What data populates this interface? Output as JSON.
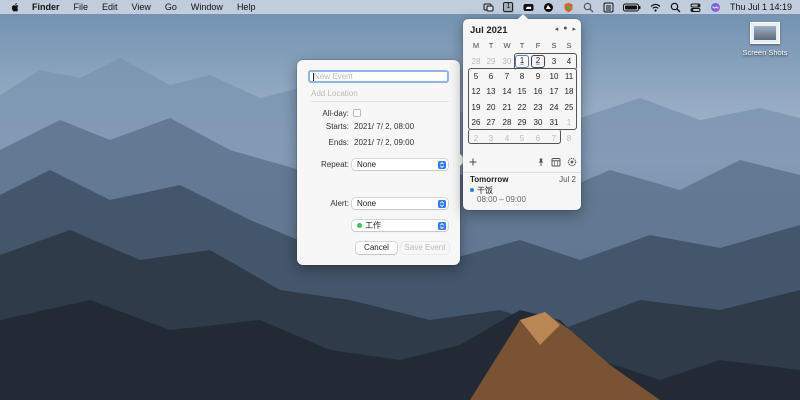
{
  "menubar": {
    "app_name": "Finder",
    "menus": [
      "File",
      "Edit",
      "View",
      "Go",
      "Window",
      "Help"
    ],
    "calendar_icon_day": "1",
    "clock": "Thu Jul 1  14:19",
    "status_icons": [
      "screen-share-icon",
      "calendar-day-icon",
      "cloud-icon",
      "dark-circle-icon",
      "shield-icon",
      "search-icon",
      "menu-list-icon",
      "battery-icon",
      "wifi-icon",
      "spotlight-icon",
      "control-center-icon",
      "siri-icon"
    ]
  },
  "desktop": {
    "items": [
      {
        "label": "Screen Shots"
      }
    ]
  },
  "event_dialog": {
    "title_placeholder": "New Event",
    "location_placeholder": "Add Location",
    "all_day_label": "All-day:",
    "starts_label": "Starts:",
    "starts_value": "2021/  7/  2, 08:00",
    "ends_label": "Ends:",
    "ends_value": "2021/  7/  2, 09:00",
    "repeat_label": "Repeat:",
    "repeat_value": "None",
    "alert_label": "Alert:",
    "alert_value": "None",
    "calendar_value": "工作",
    "calendar_color": "#35c759",
    "cancel_label": "Cancel",
    "save_label": "Save Event"
  },
  "calendar": {
    "month_label": "Jul 2021",
    "nav": {
      "prev": "◂",
      "today": "●",
      "next": "▸"
    },
    "weekdays": [
      "M",
      "T",
      "W",
      "T",
      "F",
      "S",
      "S"
    ],
    "weeks": [
      [
        "28",
        "29",
        "30",
        "1",
        "2",
        "3",
        "4"
      ],
      [
        "5",
        "6",
        "7",
        "8",
        "9",
        "10",
        "11"
      ],
      [
        "12",
        "13",
        "14",
        "15",
        "16",
        "17",
        "18"
      ],
      [
        "19",
        "20",
        "21",
        "22",
        "23",
        "24",
        "25"
      ],
      [
        "26",
        "27",
        "28",
        "29",
        "30",
        "31",
        "1"
      ],
      [
        "2",
        "3",
        "4",
        "5",
        "6",
        "7",
        "8"
      ]
    ],
    "today": "1",
    "selected": "2",
    "accent": "#2f7cf6",
    "upcoming": {
      "heading": "Tomorrow",
      "date": "Jul 2",
      "event_title": "干饭",
      "event_time": "08:00 – 09:00"
    }
  }
}
